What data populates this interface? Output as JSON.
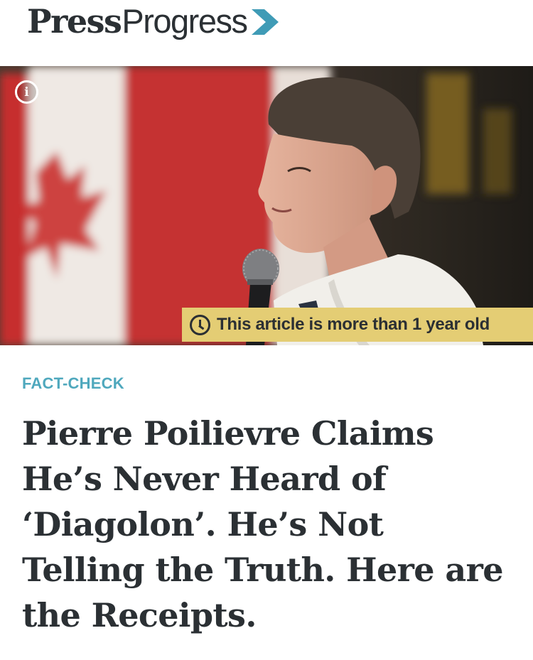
{
  "header": {
    "logo_press": "Press",
    "logo_progress": "Progress",
    "logo_arrow_icon": "chevron-right-icon",
    "accent_color": "#3f9bb6"
  },
  "hero": {
    "info_icon_glyph": "i",
    "age_notice": "This article is more than 1 year old",
    "age_notice_color": "#e4cd74",
    "clock_icon": "clock-icon"
  },
  "article": {
    "category": "FACT-CHECK",
    "category_color": "#4fa8bd",
    "headline": "Pierre Poilievre Claims He’s Never Heard of ‘Diagolon’. He’s Not Telling the Truth. Here are the Receipts."
  }
}
